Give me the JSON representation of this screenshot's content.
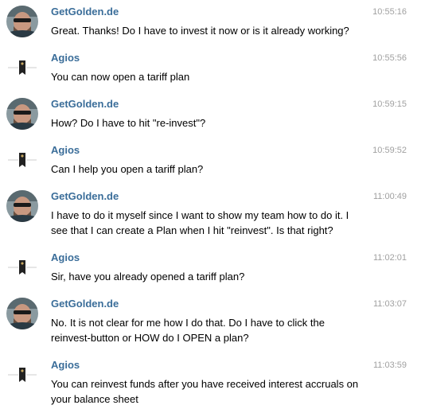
{
  "messages": [
    {
      "sender": "GetGolden.de",
      "avatar": "user-photo-avatar",
      "time": "10:55:16",
      "text": "Great. Thanks! Do I have to invest it now or is it already working?"
    },
    {
      "sender": "Agios",
      "avatar": "agios-capital-logo-avatar",
      "logo_text": "AGIOS CAPITAL",
      "time": "10:55:56",
      "text": "You can now open a tariff plan"
    },
    {
      "sender": "GetGolden.de",
      "avatar": "user-photo-avatar",
      "time": "10:59:15",
      "text": "How? Do I have to hit \"re-invest\"?"
    },
    {
      "sender": "Agios",
      "avatar": "agios-capital-logo-avatar",
      "logo_text": "AGIOS CAPITAL",
      "time": "10:59:52",
      "text": "Can I help you open a tariff plan?"
    },
    {
      "sender": "GetGolden.de",
      "avatar": "user-photo-avatar",
      "time": "11:00:49",
      "text": "I have to do it myself since I want to show my team how to do it. I see that I can create a Plan when I hit \"reinvest\". Is that right?"
    },
    {
      "sender": "Agios",
      "avatar": "agios-capital-logo-avatar",
      "logo_text": "AGIOS CAPITAL",
      "time": "11:02:01",
      "text": "Sir, have you already opened a tariff plan?"
    },
    {
      "sender": "GetGolden.de",
      "avatar": "user-photo-avatar",
      "time": "11:03:07",
      "text": "No. It is not clear for me how I do that. Do I have to click the reinvest-button or HOW do I OPEN a plan?"
    },
    {
      "sender": "Agios",
      "avatar": "agios-capital-logo-avatar",
      "logo_text": "AGIOS CAPITAL",
      "time": "11:03:59",
      "text": "You can reinvest funds after you have received interest accruals on your balance sheet"
    }
  ],
  "colors": {
    "sender": "#3a6d99",
    "time": "#a0a0a0",
    "text": "#000000"
  }
}
